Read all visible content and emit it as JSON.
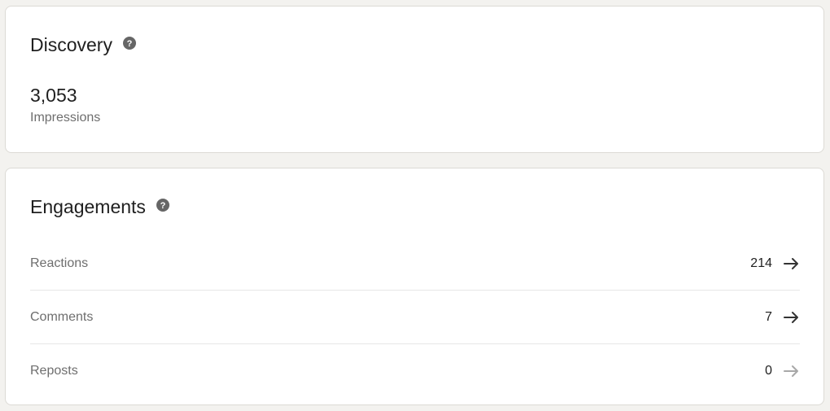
{
  "discovery": {
    "title": "Discovery",
    "impressions_value": "3,053",
    "impressions_label": "Impressions"
  },
  "engagements": {
    "title": "Engagements",
    "rows": [
      {
        "label": "Reactions",
        "count": "214",
        "arrow_color": "#333333"
      },
      {
        "label": "Comments",
        "count": "7",
        "arrow_color": "#333333"
      },
      {
        "label": "Reposts",
        "count": "0",
        "arrow_color": "#a8a8a8"
      }
    ]
  },
  "colors": {
    "page_background": "#f3f2ef",
    "card_background": "#ffffff",
    "icon_color": "#666666"
  }
}
